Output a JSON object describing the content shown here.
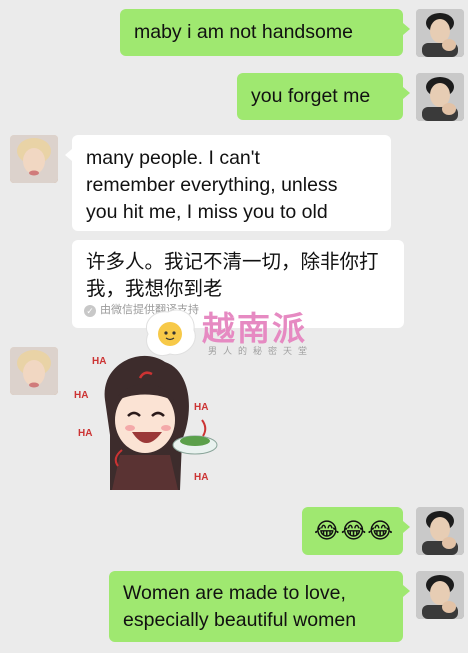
{
  "messages": [
    {
      "side": "me",
      "text": "maby i am  not handsome"
    },
    {
      "side": "me",
      "text": "you forget me"
    },
    {
      "side": "her",
      "lines": [
        "many people.  I can't",
        "remember everything, unless",
        "you hit me, I miss you to old"
      ]
    },
    {
      "side": "her",
      "lines": [
        "许多人。我记不清一切，除非你打",
        "我，我想你到老"
      ],
      "translation_note": "由微信提供翻译支持"
    },
    {
      "side": "her",
      "sticker": {
        "labels": [
          "HA",
          "HA",
          "HA",
          "HA",
          "HA"
        ]
      }
    },
    {
      "side": "me",
      "text": "😂😂😂"
    },
    {
      "side": "me",
      "lines": [
        "Women are made to love,",
        "especially beautiful women"
      ]
    }
  ],
  "watermark": {
    "title": "越南派",
    "subtitle": "男人的秘密天堂"
  },
  "colors": {
    "background": "#ebebeb",
    "my_bubble": "#9fe870",
    "her_bubble": "#ffffff"
  },
  "icons": {
    "translation_check": "check-circle-icon"
  }
}
